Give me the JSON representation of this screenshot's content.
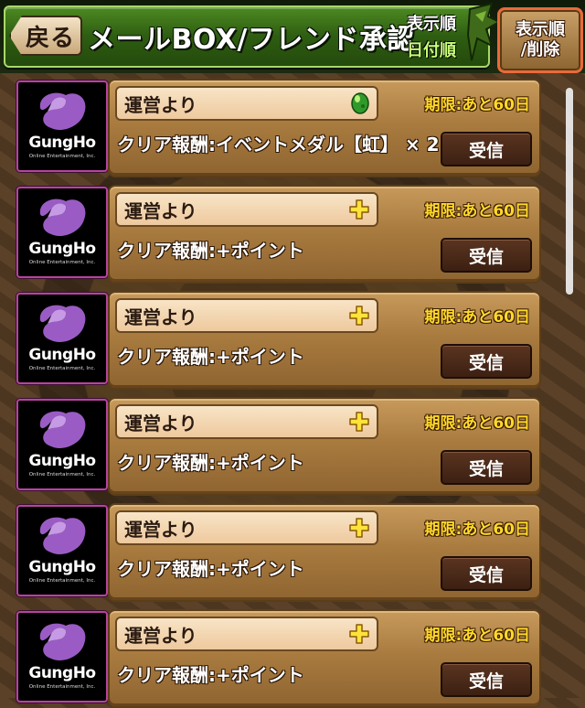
{
  "header": {
    "back_label": "戻る",
    "title": "メールBOX/フレンド承認",
    "sort_label": "表示順",
    "sort_value": "日付順",
    "sort_delete_line1": "表示順",
    "sort_delete_line2": "/削除"
  },
  "avatar": {
    "brand": "GungHo",
    "sub": "Online Entertainment, Inc."
  },
  "mails": [
    {
      "sender": "運営より",
      "reward": "クリア報酬:イベントメダル【虹】 × 2",
      "expiry": "期限:あと60日",
      "button": "受信",
      "icon": "green-egg-icon"
    },
    {
      "sender": "運営より",
      "reward": "クリア報酬:+ポイント",
      "expiry": "期限:あと60日",
      "button": "受信",
      "icon": "plus-icon"
    },
    {
      "sender": "運営より",
      "reward": "クリア報酬:+ポイント",
      "expiry": "期限:あと60日",
      "button": "受信",
      "icon": "plus-icon"
    },
    {
      "sender": "運営より",
      "reward": "クリア報酬:+ポイント",
      "expiry": "期限:あと60日",
      "button": "受信",
      "icon": "plus-icon"
    },
    {
      "sender": "運営より",
      "reward": "クリア報酬:+ポイント",
      "expiry": "期限:あと60日",
      "button": "受信",
      "icon": "plus-icon"
    },
    {
      "sender": "運営より",
      "reward": "クリア報酬:+ポイント",
      "expiry": "期限:あと60日",
      "button": "受信",
      "icon": "plus-icon"
    }
  ],
  "colors": {
    "title_bar": "#2f5e12",
    "expiry_text": "#ffd92a",
    "avatar_border": "#b6459c",
    "gh_purple": "#9a5cc4"
  }
}
